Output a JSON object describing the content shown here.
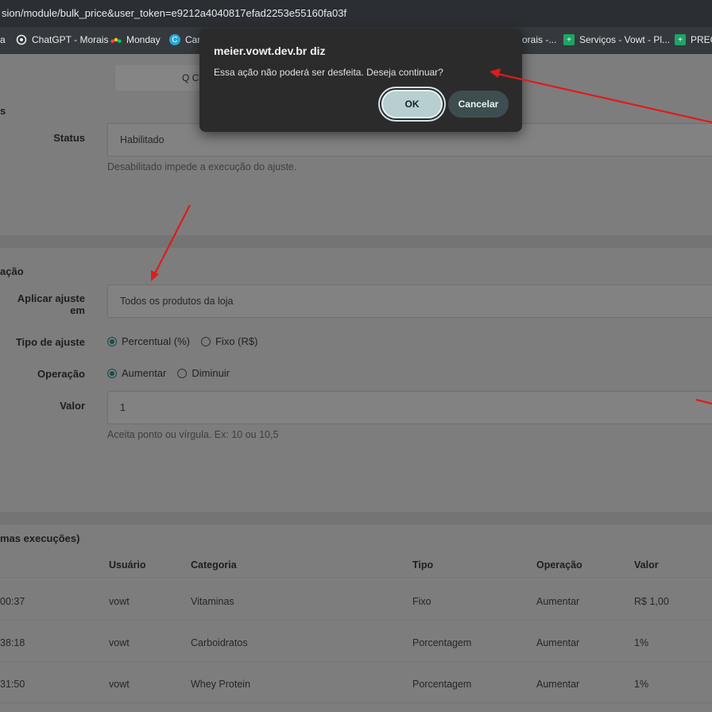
{
  "browser": {
    "url": "sion/module/bulk_price&user_token=e9212a4040817efad2253e55160fa03f",
    "bookmarks": [
      {
        "label": "a",
        "icon": "",
        "icon_color": ""
      },
      {
        "label": "ChatGPT - Morais",
        "icon": "openai-icon",
        "icon_color": "#e8eaed"
      },
      {
        "label": "Monday",
        "icon": "monday-icon",
        "icon_color": "#ff5a5a"
      },
      {
        "label": "Car",
        "icon": "canva-icon",
        "icon_color": "#2aa7d8"
      },
      {
        "label": "orais -...",
        "icon": "",
        "icon_color": ""
      },
      {
        "label": "Serviços - Vowt - Pl...",
        "icon": "sheets-icon",
        "icon_color": "#21a366"
      },
      {
        "label": "PREÇO",
        "icon": "sheets-icon",
        "icon_color": "#21a366"
      }
    ]
  },
  "search_tab": {
    "label": "Q C"
  },
  "status_section": {
    "title": "s",
    "status_label": "Status",
    "status_value": "Habilitado",
    "status_help": "Desabilitado impede a execução do ajuste."
  },
  "config_section": {
    "title": "ação",
    "apply_label": "Aplicar ajuste em",
    "apply_value": "Todos os produtos da loja",
    "type_label": "Tipo de ajuste",
    "type_options": [
      "Percentual (%)",
      "Fixo (R$)"
    ],
    "operation_label": "Operação",
    "operation_options": [
      "Aumentar",
      "Diminuir"
    ],
    "value_label": "Valor",
    "value_value": "1",
    "value_help": "Aceita ponto ou vírgula. Ex: 10 ou 10,5"
  },
  "history_section": {
    "title": "mas execuções)",
    "columns": [
      "Usuário",
      "Categoria",
      "Tipo",
      "Operação",
      "Valor"
    ],
    "rows": [
      {
        "time": "00:37",
        "user": "vowt",
        "category": "Vitaminas",
        "type": "Fixo",
        "operation": "Aumentar",
        "value": "R$ 1,00"
      },
      {
        "time": "38:18",
        "user": "vowt",
        "category": "Carboidratos",
        "type": "Porcentagem",
        "operation": "Aumentar",
        "value": "1%"
      },
      {
        "time": "31:50",
        "user": "vowt",
        "category": "Whey Protein",
        "type": "Porcentagem",
        "operation": "Aumentar",
        "value": "1%"
      }
    ]
  },
  "dialog": {
    "title": "meier.vowt.dev.br diz",
    "message": "Essa ação não poderá ser desfeita. Deseja continuar?",
    "ok_label": "OK",
    "cancel_label": "Cancelar"
  },
  "colors": {
    "accent": "#1c4b4b",
    "annotation_arrow": "#e01b1b"
  }
}
